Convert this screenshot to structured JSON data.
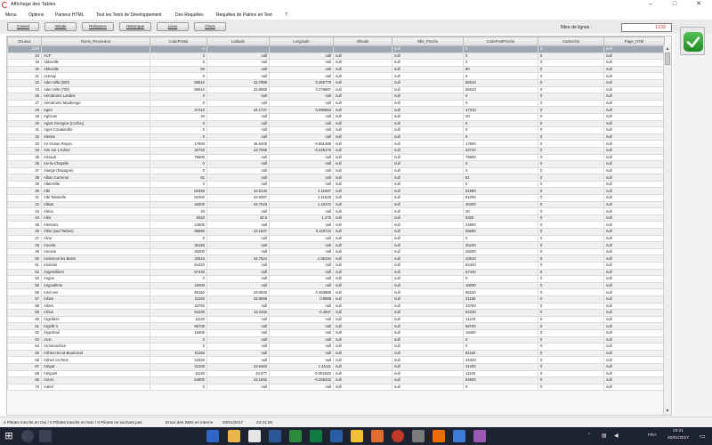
{
  "window": {
    "title": "Affichage des Tables",
    "minimize": "–",
    "maximize": "□",
    "close": "✕"
  },
  "menu": [
    "Menu",
    "Options",
    "Parseur HTML",
    "Tout les Tests de Développement",
    "Des Requêtes",
    "Requêtes de Patrice en Test",
    "?"
  ],
  "toolbar": {
    "buttons": [
      "Cansel",
      "Initiale",
      "Relisance",
      "Historique",
      "Lieux",
      "Choix"
    ],
    "rows_label": "Nbre de lignes :",
    "rows_value": "1139"
  },
  "grid": {
    "columns": [
      "IDLieux",
      "Noms_Recension",
      "CodePostal",
      "Latitude",
      "Longitude",
      "Altitude",
      "Ville_Proche",
      "CodePostProche",
      "CodeInfos",
      "Page_HTM"
    ],
    "rows": [
      [
        "1140",
        "",
        "0",
        "",
        "",
        "",
        "null",
        "0",
        "0",
        "null"
      ],
      [
        "24",
        "ACF",
        "0",
        "null",
        "null",
        "null",
        "null",
        "0",
        "0",
        "null"
      ],
      [
        "19",
        "Abbeville",
        "0",
        "null",
        "null",
        "null",
        "null",
        "0",
        "0",
        "null"
      ],
      [
        "20",
        "Abbeville",
        "80",
        "null",
        "null",
        "null",
        "null",
        "80",
        "0",
        "null"
      ],
      [
        "21",
        "Acenay",
        "0",
        "null",
        "null",
        "null",
        "null",
        "0",
        "0",
        "null"
      ],
      [
        "22",
        "Ader-Ville (600)",
        "65510",
        "42.7989",
        "0.382778",
        "null",
        "null",
        "65510",
        "0",
        "null"
      ],
      [
        "23",
        "Ader-Ville (700)",
        "65510",
        "42.8069",
        "0.376667",
        "null",
        "null",
        "65510",
        "0",
        "null"
      ],
      [
        "26",
        "Aérodrome Landes",
        "0",
        "null",
        "null",
        "null",
        "null",
        "0",
        "0",
        "null"
      ],
      [
        "27",
        "Aérodrome Maubeuge",
        "0",
        "null",
        "null",
        "null",
        "null",
        "0",
        "0",
        "null"
      ],
      [
        "28",
        "Agen",
        "47310",
        "44.1747",
        "0.590553",
        "null",
        "null",
        "47310",
        "0",
        "null"
      ],
      [
        "29",
        "Aghione",
        "20",
        "null",
        "null",
        "null",
        "null",
        "20",
        "0",
        "null"
      ],
      [
        "30",
        "Agios Georgios (Corfou)",
        "0",
        "null",
        "null",
        "null",
        "null",
        "0",
        "0",
        "null"
      ],
      [
        "31",
        "Agon Coutainville",
        "0",
        "null",
        "null",
        "null",
        "null",
        "0",
        "0",
        "null"
      ],
      [
        "32",
        "Ahetze",
        "0",
        "null",
        "null",
        "null",
        "null",
        "0",
        "0",
        "null"
      ],
      [
        "33",
        "Air Ocean Royan",
        "17600",
        "45.6208",
        "-0.851389",
        "null",
        "null",
        "17600",
        "0",
        "null"
      ],
      [
        "34",
        "Aire sur L'Adour",
        "32720",
        "43.7095",
        "-0.245278",
        "null",
        "null",
        "32720",
        "0",
        "null"
      ],
      [
        "35",
        "Airvault",
        "79600",
        "null",
        "null",
        "null",
        "null",
        "79600",
        "0",
        "null"
      ],
      [
        "36",
        "Aix-la-Chapelle",
        "0",
        "null",
        "null",
        "null",
        "null",
        "0",
        "0",
        "null"
      ],
      [
        "37",
        "Alange (Espagne)",
        "0",
        "null",
        "null",
        "null",
        "null",
        "0",
        "0",
        "null"
      ],
      [
        "38",
        "Alban Carrenet",
        "81",
        "null",
        "null",
        "null",
        "null",
        "81",
        "0",
        "null"
      ],
      [
        "39",
        "Albertville",
        "0",
        "null",
        "null",
        "null",
        "null",
        "0",
        "0",
        "null"
      ],
      [
        "40",
        "Albi",
        "81990",
        "43.9133",
        "2.11667",
        "null",
        "null",
        "81990",
        "0",
        "null"
      ],
      [
        "41",
        "Albi Tabarelle",
        "81000",
        "43.9367",
        "2.11528",
        "null",
        "null",
        "81000",
        "0",
        "null"
      ],
      [
        "42",
        "Albias",
        "46300",
        "44.7519",
        "1.43472",
        "null",
        "null",
        "46300",
        "0",
        "null"
      ],
      [
        "43",
        "Aleria",
        "20",
        "null",
        "null",
        "null",
        "null",
        "20",
        "0",
        "null"
      ],
      [
        "44",
        "Alès",
        "9320",
        "42.9",
        "1.275",
        "null",
        "null",
        "9320",
        "0",
        "null"
      ],
      [
        "45",
        "Alemans",
        "24600",
        "null",
        "null",
        "null",
        "null",
        "24600",
        "0",
        "null"
      ],
      [
        "46",
        "Allier (sud Tarbes)",
        "65690",
        "43.1847",
        "0.119722",
        "null",
        "null",
        "65690",
        "0",
        "null"
      ],
      [
        "47",
        "Alvor",
        "0",
        "null",
        "null",
        "null",
        "null",
        "0",
        "0",
        "null"
      ],
      [
        "48",
        "Ancelis",
        "35150",
        "null",
        "null",
        "null",
        "null",
        "35150",
        "0",
        "null"
      ],
      [
        "49",
        "Ancone",
        "26200",
        "null",
        "null",
        "null",
        "null",
        "26200",
        "0",
        "null"
      ],
      [
        "50",
        "Andernos les Bains",
        "33510",
        "44.7544",
        "-1.06194",
        "null",
        "null",
        "33510",
        "0",
        "null"
      ],
      [
        "51",
        "Andoins",
        "64420",
        "null",
        "null",
        "null",
        "null",
        "64420",
        "0",
        "null"
      ],
      [
        "52",
        "Angervilliers",
        "57440",
        "null",
        "null",
        "null",
        "null",
        "57440",
        "0",
        "null"
      ],
      [
        "53",
        "Angos",
        "0",
        "null",
        "null",
        "null",
        "null",
        "0",
        "0",
        "null"
      ],
      [
        "55",
        "Angoulême",
        "16000",
        "null",
        "null",
        "null",
        "null",
        "16000",
        "0",
        "null"
      ],
      [
        "56",
        "Anol ves",
        "65150",
        "43.0828",
        "0.463889",
        "null",
        "null",
        "65150",
        "0",
        "null"
      ],
      [
        "57",
        "Arbas",
        "31160",
        "42.9698",
        "0.8858",
        "null",
        "null",
        "31160",
        "0",
        "null"
      ],
      [
        "58",
        "Arbes",
        "33760",
        "null",
        "null",
        "null",
        "null",
        "33760",
        "0",
        "null"
      ],
      [
        "59",
        "Arbus",
        "64230",
        "43.3155",
        "-0.4947",
        "null",
        "null",
        "64230",
        "0",
        "null"
      ],
      [
        "60",
        "Argelliers",
        "11120",
        "null",
        "null",
        "null",
        "null",
        "11120",
        "0",
        "null"
      ],
      [
        "61",
        "ArgelÈ`s",
        "66700",
        "null",
        "null",
        "null",
        "null",
        "66700",
        "0",
        "null"
      ],
      [
        "62",
        "Argenhali",
        "19400",
        "null",
        "null",
        "null",
        "null",
        "19400",
        "0",
        "null"
      ],
      [
        "63",
        "Aron",
        "0",
        "null",
        "null",
        "null",
        "null",
        "0",
        "0",
        "null"
      ],
      [
        "64",
        "Arromanches",
        "0",
        "null",
        "null",
        "null",
        "null",
        "0",
        "0",
        "null"
      ],
      [
        "65",
        "Arthes Hecot-Boumozel",
        "81160",
        "null",
        "null",
        "null",
        "null",
        "81160",
        "0",
        "null"
      ],
      [
        "66",
        "Arthez en Retz",
        "44320",
        "null",
        "null",
        "null",
        "null",
        "44320",
        "0",
        "null"
      ],
      [
        "67",
        "Artigat",
        "31200",
        "43.6483",
        "1.44111",
        "null",
        "null",
        "31200",
        "0",
        "null"
      ],
      [
        "68",
        "Artigues",
        "11140",
        "43.577",
        "0.00194S",
        "null",
        "null",
        "11140",
        "0",
        "null"
      ],
      [
        "69",
        "Ascon",
        "64800",
        "43.1692",
        "-0.258333",
        "null",
        "null",
        "64800",
        "0",
        "null"
      ],
      [
        "70",
        "Aubel",
        "0",
        "null",
        "null",
        "null",
        "null",
        "0",
        "0",
        "null"
      ]
    ]
  },
  "status": {
    "pilots": "2 Pilotes Inscrits en Oui / 0 Pilotes Inscrits en Non / 0 Pilotes ne sachant pas",
    "sms": "Envoi des SMS en Interne",
    "date": "20/01/2017",
    "time": "23:21:28"
  },
  "taskbar": {
    "lang": "FRA",
    "clock_time": "23:21",
    "clock_date": "20/01/2017"
  },
  "colors": {
    "selected_row": "#9fa7b4",
    "rows_value": "#c0392b",
    "ok_green": "#1f8a24",
    "taskbar": "#1d2330"
  }
}
